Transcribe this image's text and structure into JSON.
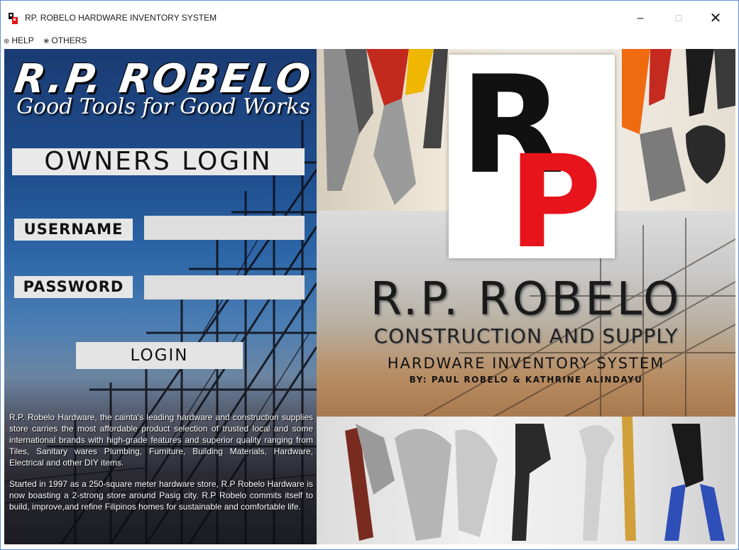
{
  "window": {
    "title": "RP. ROBELO HARDWARE INVENTORY SYSTEM",
    "controls": {
      "minimize": "–",
      "maximize": "☐",
      "close": "✕"
    }
  },
  "menu": {
    "items": [
      {
        "label": "HELP",
        "icon": "help-icon",
        "glyph": "⊕"
      },
      {
        "label": "OTHERS",
        "icon": "gear-icon",
        "glyph": "❀"
      }
    ]
  },
  "login": {
    "brand_name": "R.P. ROBELO",
    "tagline": "Good Tools for Good Works",
    "heading": "OWNERS LOGIN",
    "username_label": "USERNAME",
    "username_value": "",
    "password_label": "PASSWORD",
    "password_value": "",
    "login_button": "LOGIN"
  },
  "about": {
    "paragraph1": "R.P. Robelo Hardware, the cainta's leading hardware and construction supplies store carries the most affordable product selection of trusted local and some international brands with high-grade features and superior quality ranging from Tiles, Sanitary wares Plumbing, Furniture, Building Materials, Hardware, Electrical and other DIY items.",
    "paragraph2": "Started in 1997 as a 250-square meter hardware store, R.P Robelo Hardware is now boasting a 2-strong store around Pasig city. R.P Robelo commits itself to build, improve,and refine Filipinos homes for sustainable and comfortable life."
  },
  "banner": {
    "logo_letters": [
      "R",
      "P"
    ],
    "title": "R.P. ROBELO",
    "subtitle": "CONSTRUCTION AND SUPPLY",
    "system": "HARDWARE INVENTORY SYSTEM",
    "credits": "BY: PAUL ROBELO & KATHRINE ALINDAYU"
  },
  "colors": {
    "logo_black": "#111111",
    "logo_red": "#e8141b",
    "input_bg": "#dedede",
    "label_bg": "#e6e6e6"
  }
}
